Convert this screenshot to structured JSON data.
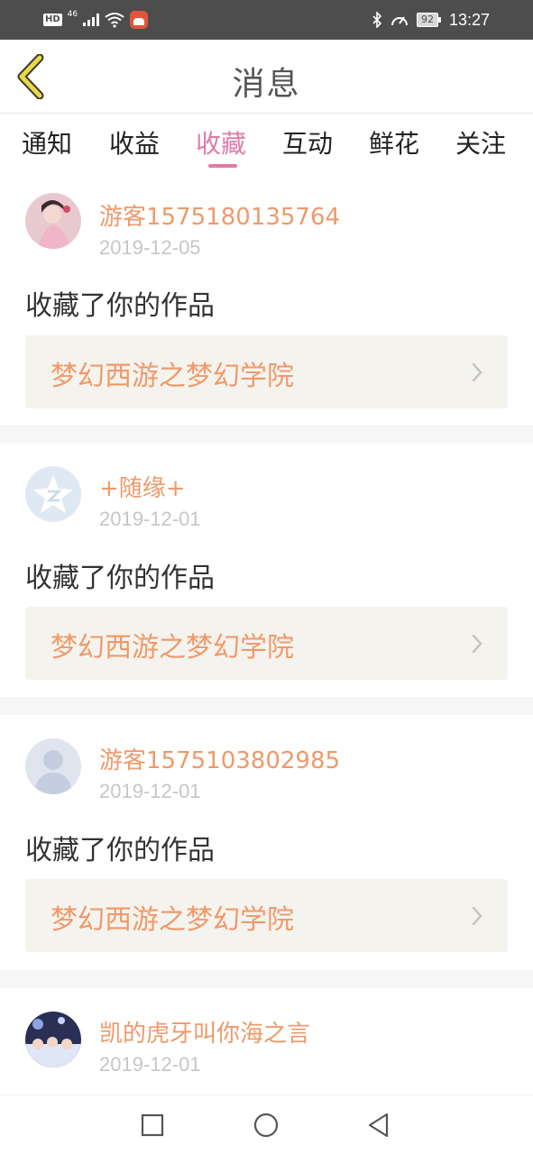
{
  "status_bar": {
    "hd_badge": "HD",
    "network": "46",
    "battery": "92",
    "time": "13:27"
  },
  "header": {
    "title": "消息",
    "back_icon": "chevron-left-icon",
    "accent_color": "#e8d84a"
  },
  "tabs": [
    {
      "label": "通知",
      "active": false
    },
    {
      "label": "收益",
      "active": false
    },
    {
      "label": "收藏",
      "active": true
    },
    {
      "label": "互动",
      "active": false
    },
    {
      "label": "鲜花",
      "active": false
    },
    {
      "label": "关注",
      "active": false
    }
  ],
  "colors": {
    "active_tab": "#e07aa7",
    "username": "#ee9a6a",
    "date": "#c6c6c6",
    "work_box_bg": "#f5f3ee"
  },
  "messages": [
    {
      "user": "游客1575180135764",
      "date": "2019-12-05",
      "action": "收藏了你的作品",
      "work": "梦幻西游之梦幻学院",
      "avatar": "girl-photo-avatar"
    },
    {
      "user": "+随缘+",
      "date": "2019-12-01",
      "action": "收藏了你的作品",
      "work": "梦幻西游之梦幻学院",
      "avatar": "qzone-star-avatar"
    },
    {
      "user": "游客1575103802985",
      "date": "2019-12-01",
      "action": "收藏了你的作品",
      "work": "梦幻西游之梦幻学院",
      "avatar": "default-person-avatar"
    },
    {
      "user": "凯的虎牙叫你海之言",
      "date": "2019-12-01",
      "action": "",
      "work": "",
      "avatar": "group-photo-avatar"
    }
  ],
  "nav": {
    "recent_icon": "square-icon",
    "home_icon": "circle-icon",
    "back_icon": "triangle-back-icon"
  }
}
